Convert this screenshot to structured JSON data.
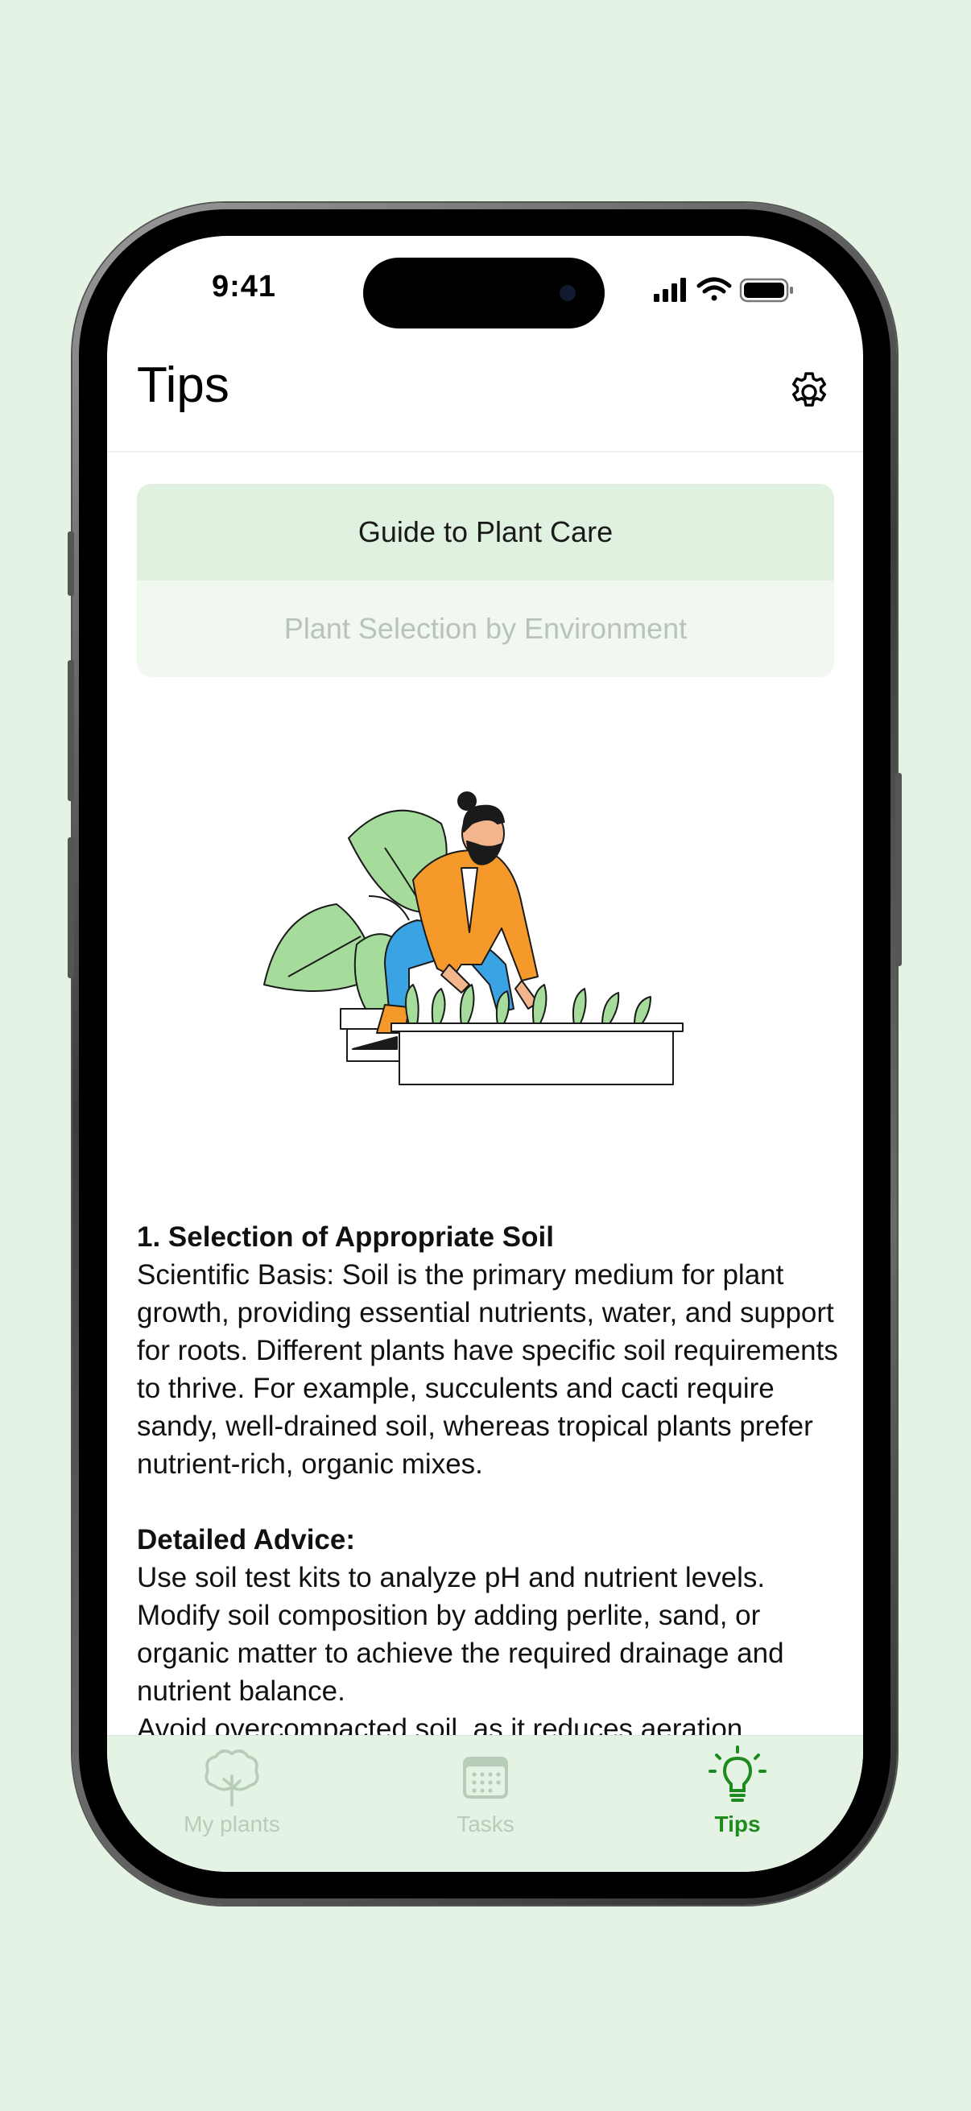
{
  "status_bar": {
    "time": "9:41"
  },
  "header": {
    "title": "Tips"
  },
  "segments": [
    {
      "label": "Guide to Plant Care",
      "selected": true
    },
    {
      "label": "Plant Selection by Environment",
      "selected": false
    }
  ],
  "article": {
    "section_title": "1. Selection of Appropriate Soil",
    "paragraph": "Scientific Basis: Soil is the primary medium for plant growth, providing essential nutrients, water, and support for roots. Different plants have specific soil requirements to thrive. For example, succulents and cacti require sandy, well-drained soil, whereas tropical plants prefer nutrient-rich, organic mixes.",
    "advice_title": "Detailed Advice:",
    "advice_1": "Use soil test kits to analyze pH and nutrient levels.",
    "advice_2": "Modify soil composition by adding perlite, sand, or organic matter to achieve the required drainage and nutrient balance.",
    "advice_3": "Avoid overcompacted soil, as it reduces aeration"
  },
  "tabbar": {
    "tabs": [
      {
        "label": "My plants",
        "icon": "tree-icon",
        "active": false
      },
      {
        "label": "Tasks",
        "icon": "calendar-icon",
        "active": false
      },
      {
        "label": "Tips",
        "icon": "lightbulb-icon",
        "active": true
      }
    ]
  },
  "colors": {
    "background": "#e5f3e5",
    "segment_selected": "#e0f2df",
    "segment_unselected": "#f0f8ef",
    "tab_active": "#1f8a1f",
    "tab_inactive": "#b8cdb8"
  }
}
